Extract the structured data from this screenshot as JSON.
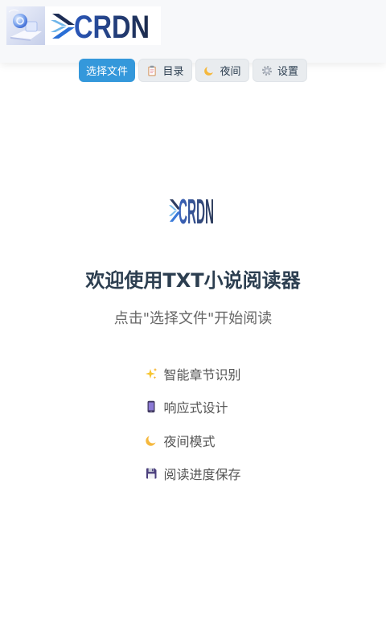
{
  "colors": {
    "accent": "#3498db",
    "header_bg": "#f7f8fa",
    "title": "#2c3e50",
    "muted": "#666666",
    "feature": "#555555",
    "button_light_bg": "#e9ecef"
  },
  "header": {
    "brand": "CRDN",
    "toolbar": [
      {
        "label": "选择文件"
      },
      {
        "label": "目录",
        "icon": "clipboard-icon"
      },
      {
        "label": "夜间",
        "icon": "moon-icon"
      },
      {
        "label": "设置",
        "icon": "gear-icon"
      }
    ]
  },
  "welcome": {
    "brand": "CRDN",
    "title": "欢迎使用TXT小说阅读器",
    "subtitle": "点击\"选择文件\"开始阅读",
    "features": [
      {
        "icon": "sparkles-icon",
        "label": "智能章节识别"
      },
      {
        "icon": "mobile-phone-icon",
        "label": "响应式设计"
      },
      {
        "icon": "moon-icon",
        "label": "夜间模式"
      },
      {
        "icon": "floppy-disk-icon",
        "label": "阅读进度保存"
      }
    ]
  }
}
